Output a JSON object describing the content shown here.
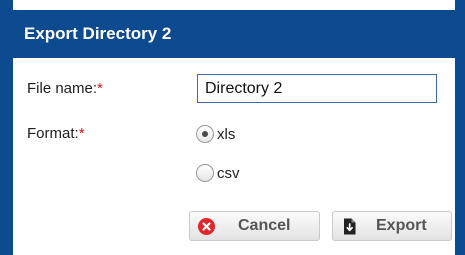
{
  "dialog": {
    "title": "Export Directory 2"
  },
  "form": {
    "file_name_label": "File name:",
    "file_name_value": "Directory 2",
    "format_label": "Format:",
    "required_marker": "*",
    "format_options": [
      {
        "label": "xls",
        "selected": true
      },
      {
        "label": "csv",
        "selected": false
      }
    ]
  },
  "buttons": {
    "cancel_label": "Cancel",
    "cancel_icon": "cancel-x-icon",
    "export_label": "Export",
    "export_icon": "export-download-icon"
  },
  "colors": {
    "titlebar": "#0d4a8f",
    "required": "#d6191f",
    "cancel_icon": "#e3262b"
  }
}
